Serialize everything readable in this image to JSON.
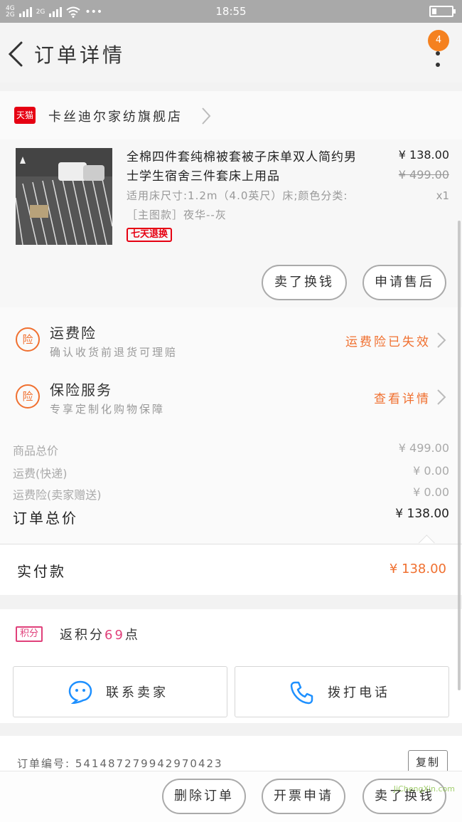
{
  "status_bar": {
    "network_1": "4G",
    "network_2": "2G",
    "network_3": "2G",
    "more": "•••",
    "time": "18:55"
  },
  "nav": {
    "title": "订单详情",
    "badge_count": "4"
  },
  "shop": {
    "badge": "天猫",
    "name": "卡丝迪尔家纺旗舰店"
  },
  "product": {
    "title": "全棉四件套纯棉被套被子床单双人简约男士学生宿舍三件套床上用品",
    "spec": "适用床尺寸:1.2m（4.0英尺）床;颜色分类:［主图款］夜华--灰",
    "price": "¥ 138.00",
    "original_price": "¥ 499.00",
    "quantity": "x1",
    "return_tag": "七天退换",
    "exchange_button": "卖了换钱",
    "aftersale_button": "申请售后"
  },
  "insurance": [
    {
      "icon": "险",
      "title": "运费险",
      "subtitle": "确认收货前退货可理赔",
      "action": "运费险已失效"
    },
    {
      "icon": "险",
      "title": "保险服务",
      "subtitle": "专享定制化购物保障",
      "action": "查看详情"
    }
  ],
  "summary": {
    "goods_label": "商品总价",
    "goods_value": "¥ 499.00",
    "shipping_label": "运费(快递)",
    "shipping_value": "¥ 0.00",
    "insurance_label": "运费险(卖家赠送)",
    "insurance_value": "¥ 0.00",
    "total_label": "订单总价",
    "total_value": "¥ 138.00"
  },
  "paid": {
    "label": "实付款",
    "value": "¥ 138.00"
  },
  "points": {
    "tag": "积分",
    "prefix": "返积分",
    "count": "69",
    "suffix": "点"
  },
  "contact": {
    "seller": "联系卖家",
    "call": "拨打电话"
  },
  "order": {
    "number_label": "订单编号: 541487279942970423",
    "copy": "复制"
  },
  "bottom_bar": {
    "delete": "删除订单",
    "invoice": "开票申请",
    "exchange": "卖了换钱"
  },
  "watermark": "JiChengXin.com",
  "colors": {
    "accent_orange": "#f07030",
    "tmall_red": "#e60012",
    "points_pink": "#e0407a",
    "badge_orange": "#f5811f",
    "icon_blue": "#1e90ff"
  }
}
